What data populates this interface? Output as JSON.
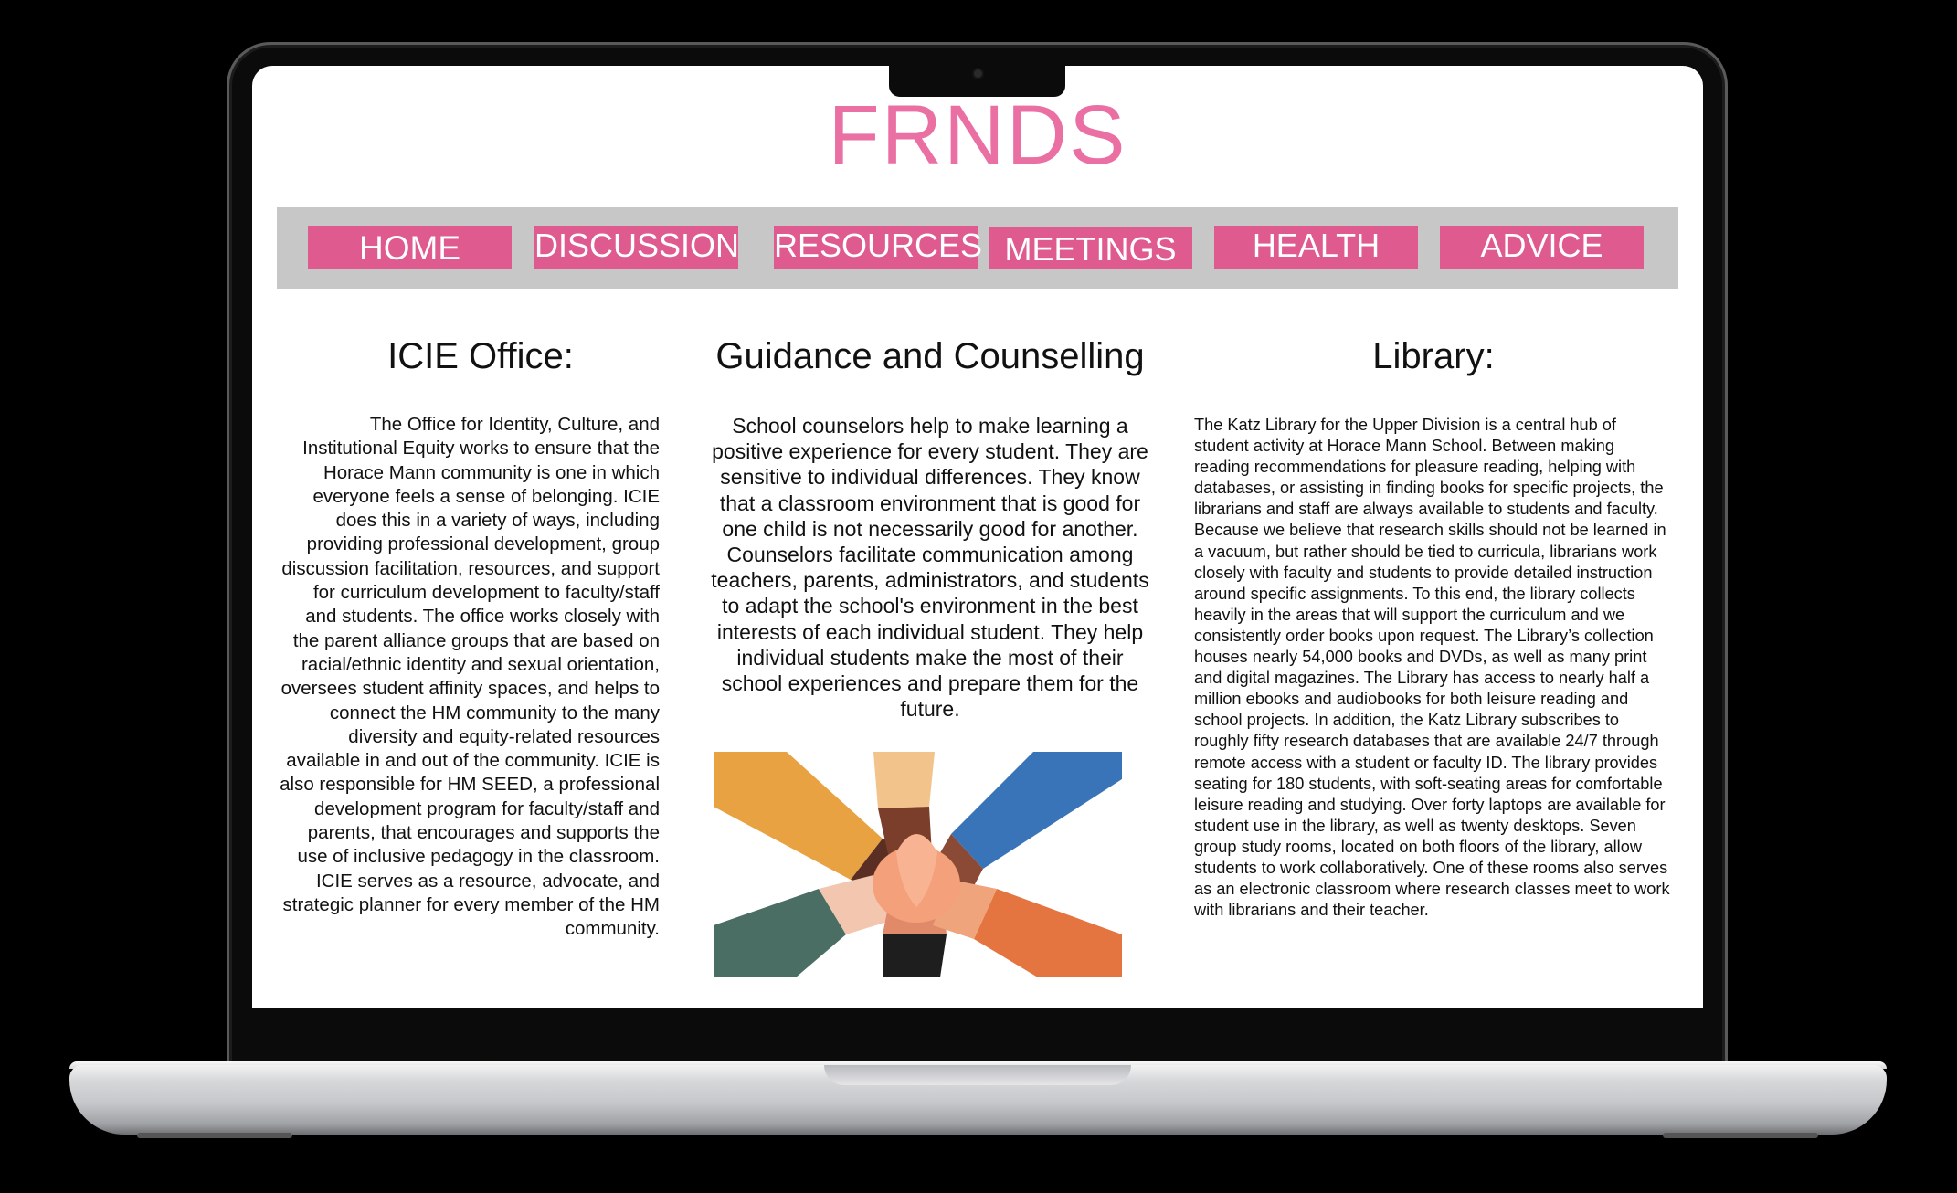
{
  "site": {
    "brand": "FRNDS"
  },
  "nav": [
    {
      "label": "HOME"
    },
    {
      "label": "DISCUSSION"
    },
    {
      "label": "RESOURCES"
    },
    {
      "label": "MEETINGS"
    },
    {
      "label": "HEALTH"
    },
    {
      "label": "ADVICE"
    }
  ],
  "columns": {
    "icie": {
      "title": "ICIE Office:",
      "body": "The Office for Identity, Culture, and Institutional Equity works to ensure that the Horace Mann community is one in which everyone feels a sense of belonging. ICIE does this in a variety of ways, including providing professional development, group discussion facilitation, resources, and support for curriculum development to faculty/staff and students. The office works closely with the parent alliance groups that are based on racial/ethnic identity and sexual orientation, oversees student affinity spaces, and helps to connect the HM community to the many diversity and equity-related resources available in and out of the community. ICIE is also responsible for HM SEED, a professional development program for faculty/staff and parents, that encourages and supports the use of inclusive pedagogy in the classroom. ICIE serves as a resource, advocate, and strategic planner for every member of the HM community."
    },
    "guidance": {
      "title": "Guidance and Counselling",
      "body": "School counselors help to make learning a positive experience for every student. They are sensitive to individual differences. They know that a classroom environment that is good for one child is not necessarily good for another. Counselors facilitate communication among teachers, parents, administrators, and students to adapt the school's environment in the best interests of each individual student. They help individual students make the most of their school experiences and prepare them for the future.",
      "image_icon": "stacked-hands-icon"
    },
    "library": {
      "title": "Library:",
      "body": "The Katz Library for the Upper Division is a central hub of student activity at Horace Mann School. Between making reading recommendations for pleasure reading, helping with databases, or assisting in finding books for specific projects, the librarians and staff are always available to students and faculty. Because we believe that research skills should not be learned in a vacuum, but rather should be tied to curricula, librarians work closely with faculty and students to provide detailed instruction around specific assignments. To this end, the library collects heavily in the areas that will support the curriculum and we consistently order books upon request. The Library’s collection houses nearly 54,000 books and DVDs, as well as many print and digital magazines. The Library has access to nearly half a million ebooks and audiobooks for both leisure reading and school projects. In addition, the Katz Library subscribes to roughly fifty research databases that are available 24/7 through remote access with a student or faculty ID. The library provides seating for 180 students, with soft-seating areas for comfortable leisure reading and studying. Over forty laptops are available for student use in the library, as well as twenty desktops. Seven group study rooms, located on both floors of the library, allow students to work collaboratively. One of these rooms also serves as an electronic classroom where research classes meet to work with librarians and their teacher."
    }
  },
  "colors": {
    "brand": "#ea6fa2",
    "nav_button": "#de5a8f",
    "nav_bar": "#c7c7c7"
  }
}
